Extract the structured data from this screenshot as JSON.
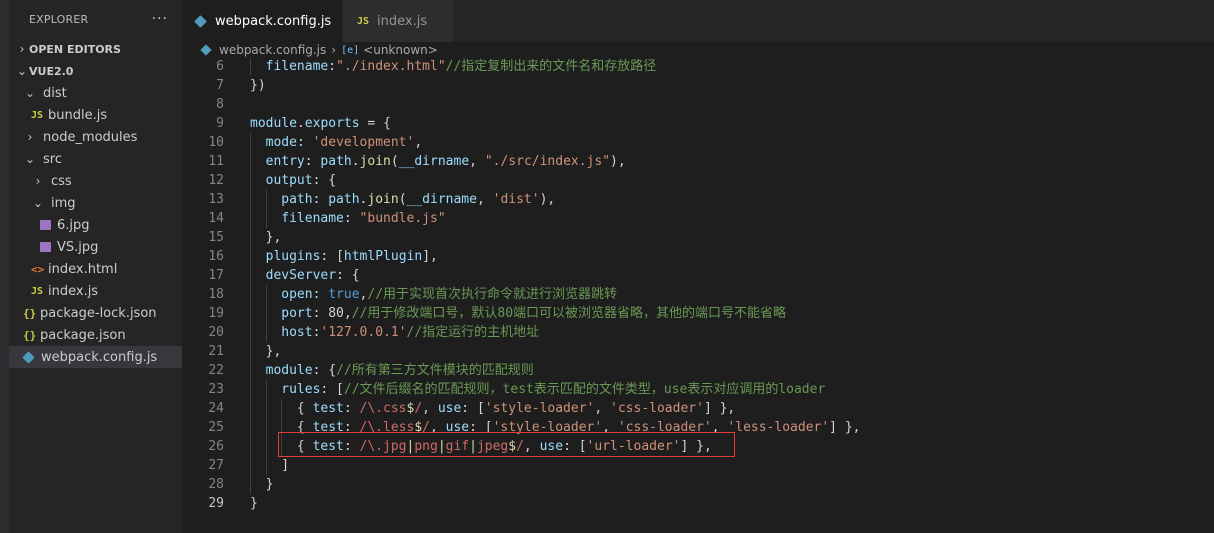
{
  "explorer": {
    "title": "EXPLORER",
    "more": "···",
    "open_editors": "OPEN EDITORS",
    "project": "VUE2.0",
    "tree": [
      {
        "label": "dist",
        "icon": "chevron-down-icon",
        "indent": 1,
        "kind": "folder-open"
      },
      {
        "label": "bundle.js",
        "icon": "js-file-icon",
        "indent": 2,
        "kind": "js"
      },
      {
        "label": "node_modules",
        "icon": "chevron-right-icon",
        "indent": 1,
        "kind": "folder"
      },
      {
        "label": "src",
        "icon": "chevron-down-icon",
        "indent": 1,
        "kind": "folder-open"
      },
      {
        "label": "css",
        "icon": "chevron-right-icon",
        "indent": 2,
        "kind": "folder"
      },
      {
        "label": "img",
        "icon": "chevron-down-icon",
        "indent": 2,
        "kind": "folder-open"
      },
      {
        "label": "6.jpg",
        "icon": "image-file-icon",
        "indent": 3,
        "kind": "img"
      },
      {
        "label": "VS.jpg",
        "icon": "image-file-icon",
        "indent": 3,
        "kind": "img"
      },
      {
        "label": "index.html",
        "icon": "html-file-icon",
        "indent": 2,
        "kind": "html"
      },
      {
        "label": "index.js",
        "icon": "js-file-icon",
        "indent": 2,
        "kind": "js"
      },
      {
        "label": "package-lock.json",
        "icon": "json-file-icon",
        "indent": 1,
        "kind": "json"
      },
      {
        "label": "package.json",
        "icon": "json-file-icon",
        "indent": 1,
        "kind": "json"
      },
      {
        "label": "webpack.config.js",
        "icon": "webpack-file-icon",
        "indent": 1,
        "kind": "webpack",
        "selected": true
      }
    ]
  },
  "tabs": [
    {
      "label": "webpack.config.js",
      "active": true
    },
    {
      "label": "index.js",
      "active": false
    }
  ],
  "breadcrumb": {
    "file": "webpack.config.js",
    "symbol_icon": "[e]",
    "symbol": "<unknown>"
  },
  "editor": {
    "current_line": 29,
    "lines": [
      {
        "n": 6,
        "indent": 1,
        "tokens": [
          [
            "id",
            "filename"
          ],
          [
            "pun",
            ":"
          ],
          [
            "str",
            "\"./index.html\""
          ],
          [
            "cm",
            "//指定复制出来的文件名和存放路径"
          ]
        ]
      },
      {
        "n": 7,
        "indent": 0,
        "tokens": [
          [
            "pun",
            "})"
          ]
        ]
      },
      {
        "n": 8,
        "indent": 0,
        "tokens": []
      },
      {
        "n": 9,
        "indent": 0,
        "tokens": [
          [
            "id",
            "module"
          ],
          [
            "pun",
            "."
          ],
          [
            "id",
            "exports"
          ],
          [
            "pun",
            " = {"
          ]
        ]
      },
      {
        "n": 10,
        "indent": 1,
        "tokens": [
          [
            "id",
            "mode"
          ],
          [
            "pun",
            ": "
          ],
          [
            "str",
            "'development'"
          ],
          [
            "pun",
            ","
          ]
        ]
      },
      {
        "n": 11,
        "indent": 1,
        "tokens": [
          [
            "id",
            "entry"
          ],
          [
            "pun",
            ": "
          ],
          [
            "id",
            "path"
          ],
          [
            "pun",
            "."
          ],
          [
            "fn",
            "join"
          ],
          [
            "pun",
            "("
          ],
          [
            "id",
            "__dirname"
          ],
          [
            "pun",
            ", "
          ],
          [
            "str",
            "\"./src/index.js\""
          ],
          [
            "pun",
            "),"
          ]
        ]
      },
      {
        "n": 12,
        "indent": 1,
        "tokens": [
          [
            "id",
            "output"
          ],
          [
            "pun",
            ": {"
          ]
        ]
      },
      {
        "n": 13,
        "indent": 2,
        "tokens": [
          [
            "id",
            "path"
          ],
          [
            "pun",
            ": "
          ],
          [
            "id",
            "path"
          ],
          [
            "pun",
            "."
          ],
          [
            "fn",
            "join"
          ],
          [
            "pun",
            "("
          ],
          [
            "id",
            "__dirname"
          ],
          [
            "pun",
            ", "
          ],
          [
            "str",
            "'dist'"
          ],
          [
            "pun",
            "),"
          ]
        ]
      },
      {
        "n": 14,
        "indent": 2,
        "tokens": [
          [
            "id",
            "filename"
          ],
          [
            "pun",
            ": "
          ],
          [
            "str",
            "\"bundle.js\""
          ]
        ]
      },
      {
        "n": 15,
        "indent": 1,
        "tokens": [
          [
            "pun",
            "},"
          ]
        ]
      },
      {
        "n": 16,
        "indent": 1,
        "tokens": [
          [
            "id",
            "plugins"
          ],
          [
            "pun",
            ": ["
          ],
          [
            "id",
            "htmlPlugin"
          ],
          [
            "pun",
            "],"
          ]
        ]
      },
      {
        "n": 17,
        "indent": 1,
        "tokens": [
          [
            "id",
            "devServer"
          ],
          [
            "pun",
            ": {"
          ]
        ]
      },
      {
        "n": 18,
        "indent": 2,
        "tokens": [
          [
            "id",
            "open"
          ],
          [
            "pun",
            ": "
          ],
          [
            "kw",
            "true"
          ],
          [
            "pun",
            ","
          ],
          [
            "cm",
            "//用于实现首次执行命令就进行浏览器跳转"
          ]
        ]
      },
      {
        "n": 19,
        "indent": 2,
        "tokens": [
          [
            "id",
            "port"
          ],
          [
            "pun",
            ": "
          ],
          [
            "pl",
            "80"
          ],
          [
            "pun",
            ","
          ],
          [
            "cm",
            "//用于修改端口号，默认80端口可以被浏览器省略，其他的端口号不能省略"
          ]
        ]
      },
      {
        "n": 20,
        "indent": 2,
        "tokens": [
          [
            "id",
            "host"
          ],
          [
            "pun",
            ":"
          ],
          [
            "str",
            "'127.0.0.1'"
          ],
          [
            "cm",
            "//指定运行的主机地址"
          ]
        ]
      },
      {
        "n": 21,
        "indent": 1,
        "tokens": [
          [
            "pun",
            "},"
          ]
        ]
      },
      {
        "n": 22,
        "indent": 1,
        "tokens": [
          [
            "id",
            "module"
          ],
          [
            "pun",
            ": {"
          ],
          [
            "cm",
            "//所有第三方文件模块的匹配规则"
          ]
        ]
      },
      {
        "n": 23,
        "indent": 2,
        "tokens": [
          [
            "id",
            "rules"
          ],
          [
            "pun",
            ": ["
          ],
          [
            "cm",
            "//文件后缀名的匹配规则，test表示匹配的文件类型，use表示对应调用的loader"
          ]
        ]
      },
      {
        "n": 24,
        "indent": 3,
        "tokens": [
          [
            "pun",
            "{ "
          ],
          [
            "id",
            "test"
          ],
          [
            "pun",
            ": "
          ],
          [
            "re",
            "/\\.css"
          ],
          [
            "dl",
            "$"
          ],
          [
            "re",
            "/"
          ],
          [
            "pun",
            ", "
          ],
          [
            "id",
            "use"
          ],
          [
            "pun",
            ": ["
          ],
          [
            "str",
            "'style-loader'"
          ],
          [
            "pun",
            ", "
          ],
          [
            "str",
            "'css-loader'"
          ],
          [
            "pun",
            "] },"
          ]
        ]
      },
      {
        "n": 25,
        "indent": 3,
        "tokens": [
          [
            "pun",
            "{ "
          ],
          [
            "id",
            "test"
          ],
          [
            "pun",
            ": "
          ],
          [
            "re",
            "/\\.less"
          ],
          [
            "dl",
            "$"
          ],
          [
            "re",
            "/"
          ],
          [
            "pun",
            ", "
          ],
          [
            "id",
            "use"
          ],
          [
            "pun",
            ": ["
          ],
          [
            "str",
            "'style-loader'"
          ],
          [
            "pun",
            ", "
          ],
          [
            "str",
            "'css-loader'"
          ],
          [
            "pun",
            ", "
          ],
          [
            "str",
            "'less-loader'"
          ],
          [
            "pun",
            "] },"
          ]
        ]
      },
      {
        "n": 26,
        "indent": 3,
        "tokens": [
          [
            "pun",
            "{ "
          ],
          [
            "id",
            "test"
          ],
          [
            "pun",
            ": "
          ],
          [
            "re",
            "/\\.jpg"
          ],
          [
            "dl",
            "|"
          ],
          [
            "re",
            "png"
          ],
          [
            "dl",
            "|"
          ],
          [
            "re",
            "gif"
          ],
          [
            "dl",
            "|"
          ],
          [
            "re",
            "jpeg"
          ],
          [
            "dl",
            "$"
          ],
          [
            "re",
            "/"
          ],
          [
            "pun",
            ", "
          ],
          [
            "id",
            "use"
          ],
          [
            "pun",
            ": ["
          ],
          [
            "str",
            "'url-loader'"
          ],
          [
            "pun",
            "] },"
          ]
        ]
      },
      {
        "n": 27,
        "indent": 2,
        "tokens": [
          [
            "pun",
            "]"
          ]
        ]
      },
      {
        "n": 28,
        "indent": 1,
        "tokens": [
          [
            "pun",
            "}"
          ]
        ]
      },
      {
        "n": 29,
        "indent": 0,
        "tokens": [
          [
            "pun",
            "}"
          ]
        ]
      }
    ]
  },
  "colors": {
    "highlight_box": "#e03c3c",
    "editor_bg": "#1e1e1e",
    "sidebar_bg": "#252526"
  }
}
